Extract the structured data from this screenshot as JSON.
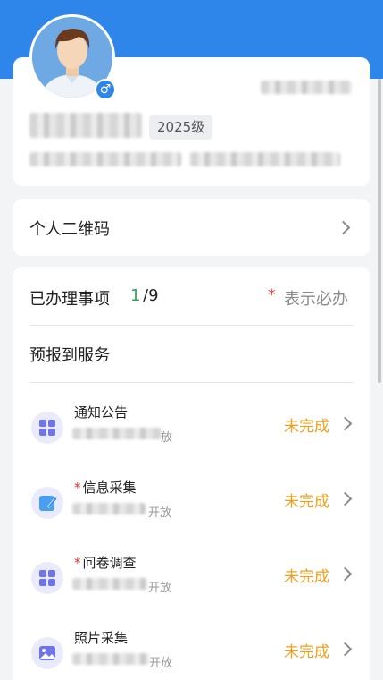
{
  "profile": {
    "grade": "2025级",
    "gender_symbol": "♂"
  },
  "qr": {
    "label": "个人二维码"
  },
  "todo": {
    "title": "已办理事项",
    "done": "1",
    "total": "/9",
    "required_star": "*",
    "required_note": "表示必办",
    "section": "预报到服务",
    "tasks": [
      {
        "name": "通知公告",
        "required": false,
        "sub": "放",
        "status": "未完成",
        "icon": "grid-apps-icon"
      },
      {
        "name": "信息采集",
        "required": true,
        "sub": "开放",
        "status": "未完成",
        "icon": "edit-note-icon"
      },
      {
        "name": "问卷调查",
        "required": true,
        "sub": "开放",
        "status": "未完成",
        "icon": "grid-apps-icon"
      },
      {
        "name": "照片采集",
        "required": false,
        "sub": "开放",
        "status": "未完成",
        "icon": "photo-icon"
      }
    ]
  },
  "colors": {
    "brand": "#2f86ea",
    "success": "#2aa85a",
    "warning": "#f0a020",
    "required": "#e5322d",
    "icon_purple": "#6f74e8"
  }
}
